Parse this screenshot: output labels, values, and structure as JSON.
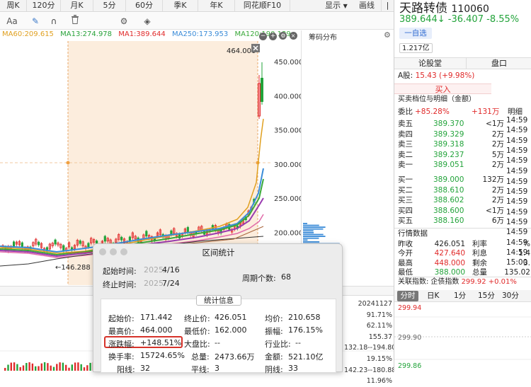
{
  "topbar": {
    "items": [
      "周K",
      "120分",
      "月K",
      "5分",
      "60分",
      "季K",
      "年K",
      "同花顺F10",
      "显示",
      "画线"
    ]
  },
  "toolbar": {
    "items": [
      "Aa",
      "✎",
      "∩",
      "🗑",
      "⚙",
      "◈"
    ]
  },
  "ma": {
    "ma60": "MA60:209.615",
    "ma13": "MA13:274.978",
    "ma1": "MA1:389.644",
    "ma250": "MA250:173.953",
    "ma120": "MA120:190.139"
  },
  "colors": {
    "ma60": "#e0a020",
    "ma13": "#28a23a",
    "ma1": "#e02a2a",
    "ma250": "#3b8cd8",
    "ma120": "#3aa93a"
  },
  "chart": {
    "annot_high": "464.000",
    "annot_low": "←146.288",
    "yticks": [
      "450.000",
      "400.000",
      "350.000",
      "300.000",
      "250.000",
      "200.000"
    ],
    "yvals": [
      450,
      400,
      350,
      300,
      250,
      200
    ]
  },
  "chips": {
    "title": "筹码分布"
  },
  "lower": {
    "values": [
      "20241127",
      "91.71%",
      "62.11%",
      "155.37",
      "132.18--194.80",
      "19.15%",
      "142.23--180.88",
      "11.96%"
    ]
  },
  "right": {
    "stock_name": "天路转债",
    "code": "110060",
    "price": "389.644↓",
    "change": "-36.407",
    "pct": "-8.55%",
    "watch": "一自选",
    "mcap": "1.217亿",
    "tabs": [
      "论股堂",
      "盘口"
    ],
    "ashare_label": "A股:",
    "ashare_value": "15.43 (+9.98%)",
    "buy_btn": "买入",
    "detail_title": "买卖档位与明细（金额）",
    "ratio_label": "委比",
    "ratio_value": "+85.28%",
    "ratio_amt": "+131万",
    "detail_tab": "明细",
    "sells": [
      [
        "卖五",
        "389.370",
        "<1万"
      ],
      [
        "卖四",
        "389.329",
        "2万"
      ],
      [
        "卖三",
        "389.318",
        "2万"
      ],
      [
        "卖二",
        "389.237",
        "5万"
      ],
      [
        "卖一",
        "389.051",
        "2万"
      ]
    ],
    "buys": [
      [
        "买一",
        "389.000",
        "132万"
      ],
      [
        "买二",
        "388.610",
        "2万"
      ],
      [
        "买三",
        "388.602",
        "2万"
      ],
      [
        "买四",
        "388.600",
        "<1万"
      ],
      [
        "买五",
        "388.160",
        "6万"
      ]
    ],
    "times": [
      "14:59",
      "14:59",
      "14:59",
      "14:59",
      "14:59",
      "14:59",
      "14:59",
      "14:59",
      "14:59",
      "14:59",
      "14:59",
      "14:59",
      "14:59",
      "14:59",
      "15:00"
    ],
    "market_title": "行情数据",
    "market": [
      [
        "昨收",
        "426.051",
        "利率",
        "%"
      ],
      [
        "今开",
        "427.640",
        "利息",
        "1.4"
      ],
      [
        "最高",
        "448.000",
        "剩余",
        "3."
      ],
      [
        "最低",
        "388.000",
        "总量",
        "135.02"
      ]
    ],
    "index_label": "关联指数:",
    "index_name": "企债指数",
    "index_value": "299.92 +0.01%",
    "timetabs": [
      "分时",
      "日K",
      "1分",
      "15分",
      "30分"
    ],
    "mini_top": "299.94",
    "mini_mid": "299.90",
    "mini_bot": "299.86"
  },
  "popup": {
    "title": "区间统计",
    "start_label": "起始时间:",
    "start_year": "2025/",
    "start_date": "4/16",
    "end_label": "终止时间:",
    "end_year": "2025/",
    "end_date": "7/24",
    "period_label": "周期个数:",
    "period_value": "68",
    "stats_tab": "统计信息",
    "stat_start": {
      "label": "起始价:",
      "value": "171.442"
    },
    "stat_end": {
      "label": "终止价:",
      "value": "426.051"
    },
    "stat_avg": {
      "label": "均价:",
      "value": "210.658"
    },
    "stat_high": {
      "label": "最高价:",
      "value": "464.000"
    },
    "stat_low": {
      "label": "最低价:",
      "value": "162.000"
    },
    "stat_amp": {
      "label": "振幅:",
      "value": "176.15%"
    },
    "stat_chg": {
      "label": "涨跌幅:",
      "value": "+148.51%"
    },
    "stat_beta": {
      "label": "大盘比:",
      "value": "--"
    },
    "stat_ind": {
      "label": "行业比:",
      "value": "--"
    },
    "stat_turn": {
      "label": "换手率:",
      "value": "15724.65%"
    },
    "stat_vol": {
      "label": "总量:",
      "value": "2473.66万"
    },
    "stat_amt": {
      "label": "金额:",
      "value": "521.10亿"
    },
    "stat_yang": {
      "label": "阳线:",
      "value": "32"
    },
    "stat_flat": {
      "label": "平线:",
      "value": "3"
    },
    "stat_yin": {
      "label": "阴线:",
      "value": "33"
    }
  }
}
